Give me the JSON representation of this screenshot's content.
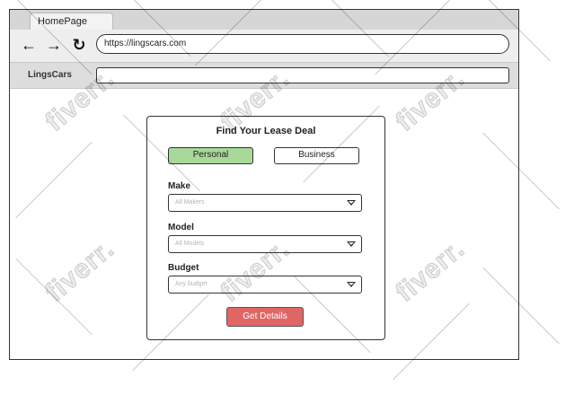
{
  "browser": {
    "tab_title": "HomePage",
    "back_glyph": "←",
    "forward_glyph": "→",
    "reload_glyph": "↻",
    "url": "https://lingscars.com"
  },
  "site": {
    "name": "LingsCars",
    "search_value": ""
  },
  "lease_form": {
    "title": "Find Your Lease Deal",
    "toggles": [
      {
        "label": "Personal",
        "active": true
      },
      {
        "label": "Business",
        "active": false
      }
    ],
    "fields": [
      {
        "label": "Make",
        "placeholder": "All Makers"
      },
      {
        "label": "Model",
        "placeholder": "All Models"
      },
      {
        "label": "Budget",
        "placeholder": "Any budget"
      }
    ],
    "submit_label": "Get Details"
  },
  "watermark": {
    "text": "fiverr."
  },
  "colors": {
    "active_toggle": "#a8d89a",
    "submit_button": "#e06666",
    "chrome_tabstrip": "#d6d6d6",
    "chrome_navbar": "#eeeeee"
  }
}
